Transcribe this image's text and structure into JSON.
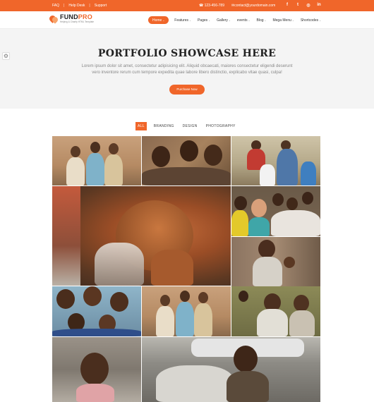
{
  "topbar": {
    "links": [
      "FAQ",
      "Help Desk",
      "Support"
    ],
    "phone": "123-456-789",
    "email": "contact@yourdomain.com",
    "social_icons": [
      "facebook-icon",
      "twitter-icon",
      "instagram-icon",
      "linkedin-icon"
    ]
  },
  "brand": {
    "name_a": "FUND",
    "name_b": "PRO",
    "tagline": "Helping & Charity HTML Template"
  },
  "nav": [
    {
      "label": "Home",
      "active": true
    },
    {
      "label": "Features"
    },
    {
      "label": "Pages"
    },
    {
      "label": "Gallery"
    },
    {
      "label": "events"
    },
    {
      "label": "Blog"
    },
    {
      "label": "Mega Menu"
    },
    {
      "label": "Shortcodes"
    }
  ],
  "hero": {
    "title": "PORTFOLIO SHOWCASE HERE",
    "text": "Lorem ipsum dolor sit amet, consectetur adipisicing elit. Aliquid obcaecati, maiores consectetur eligendi deserunt vero inventore rerum cum tempore expedita quae labore libero distinctio, explicabo vitae quasi, culpa!",
    "cta": "Purchase Now"
  },
  "filters": [
    {
      "label": "ALL",
      "active": true
    },
    {
      "label": "BRANDING"
    },
    {
      "label": "DESIGN"
    },
    {
      "label": "PHOTOGRAPHY"
    }
  ],
  "colors": {
    "accent": "#f0662a",
    "hero_bg": "#f4f4f4"
  },
  "gallery": [
    {
      "name": "photo-children-wall"
    },
    {
      "name": "photo-boys-smiling"
    },
    {
      "name": "photo-children-group-outdoor"
    },
    {
      "name": "photo-boy-drinking-water"
    },
    {
      "name": "photo-crowd-children"
    },
    {
      "name": "photo-girl-with-baby"
    },
    {
      "name": "photo-kids-making-faces"
    },
    {
      "name": "photo-children-wall-2"
    },
    {
      "name": "photo-women-smiling"
    },
    {
      "name": "photo-little-girl"
    },
    {
      "name": "photo-boy-carrying-bag"
    }
  ]
}
